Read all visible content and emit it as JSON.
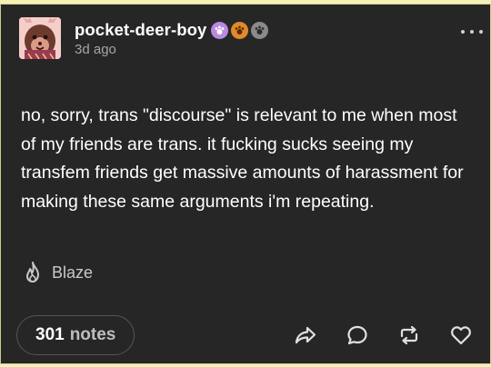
{
  "post": {
    "author": {
      "username": "pocket-deer-boy",
      "timestamp": "3d ago",
      "avatar_icon": "deer-character-avatar",
      "badges": [
        {
          "icon": "paw-badge-icon",
          "color": "#b98ae0"
        },
        {
          "icon": "paw-badge-icon",
          "color": "#e28a2b"
        },
        {
          "icon": "paw-badge-icon",
          "color": "#8a8a8a"
        }
      ]
    },
    "more_icon": "more-options-icon",
    "body": "no, sorry, trans \"discourse\" is relevant to me when most of my friends are trans. it fucking sucks seeing my transfem friends get massive amounts of harassment for making these same arguments i'm repeating.",
    "tag": {
      "label": "Blaze",
      "icon": "flame-icon"
    },
    "footer": {
      "notes_count": "301",
      "notes_label": "notes",
      "actions": [
        "share-icon",
        "reply-icon",
        "reblog-icon",
        "like-icon"
      ]
    }
  },
  "colors": {
    "background": "#262626",
    "page_background": "#f3f0b8",
    "text": "#ffffff",
    "muted_text": "#a5a5a5"
  }
}
